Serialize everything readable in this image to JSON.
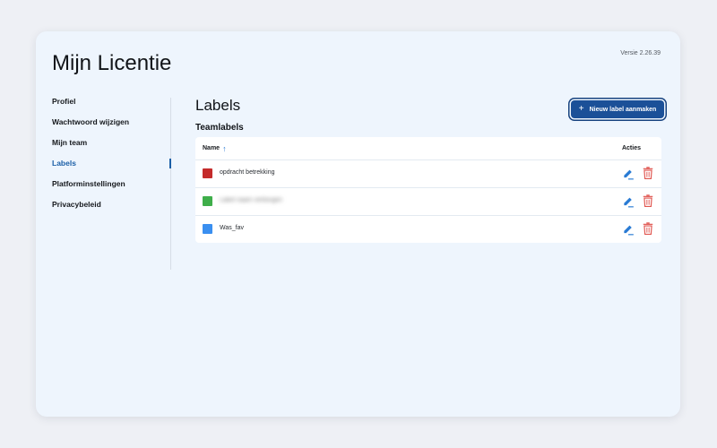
{
  "app": {
    "title": "Mijn Licentie",
    "version": "Versie 2.26.39"
  },
  "sidebar": {
    "items": [
      {
        "label": "Profiel",
        "active": false
      },
      {
        "label": "Wachtwoord wijzigen",
        "active": false
      },
      {
        "label": "Mijn team",
        "active": false
      },
      {
        "label": "Labels",
        "active": true
      },
      {
        "label": "Platforminstellingen",
        "active": false
      },
      {
        "label": "Privacybeleid",
        "active": false
      }
    ]
  },
  "main": {
    "title": "Labels",
    "section_title": "Teamlabels",
    "new_label_button": {
      "icon": "plus-icon",
      "label": "Nieuw label aanmaken"
    },
    "table": {
      "columns": {
        "name": "Name",
        "actions": "Acties"
      },
      "sort": {
        "column": "name",
        "direction": "ascending",
        "icon": "arrow-up-icon"
      },
      "rows": [
        {
          "name": "opdracht betrekking",
          "color": "#c42b2b",
          "blurred": false
        },
        {
          "name": "Label naam verborgen",
          "color": "#3fae4a",
          "blurred": true
        },
        {
          "name": "Was_fav",
          "color": "#3a8ff0",
          "blurred": false
        }
      ],
      "row_actions": {
        "edit_icon": "pencil-icon",
        "delete_icon": "trash-icon"
      }
    }
  },
  "colors": {
    "accent": "#1b5098",
    "active_nav": "#1b5fa7",
    "edit": "#2a7bd4",
    "delete": "#e0554f",
    "page_background": "#eef5fd"
  }
}
